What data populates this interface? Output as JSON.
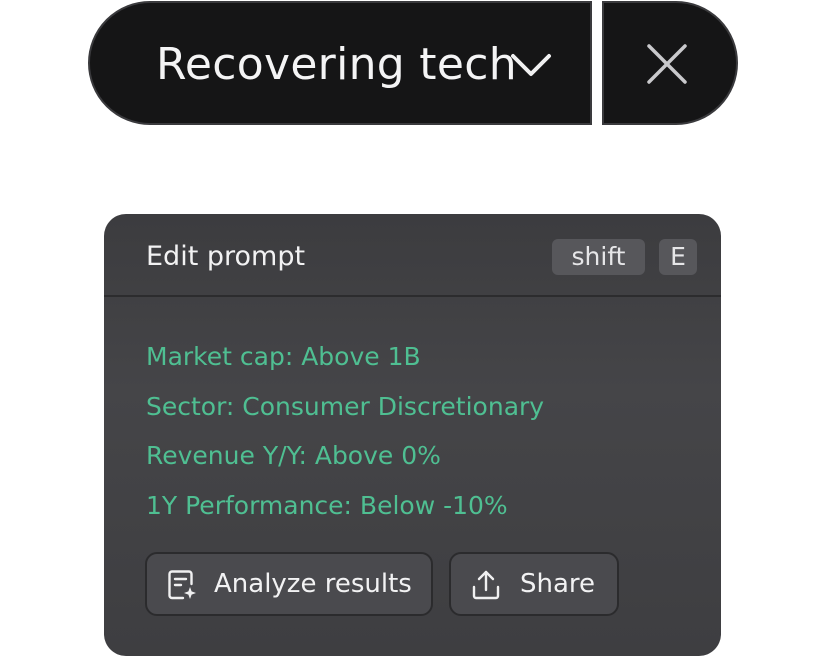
{
  "screen_selector": {
    "title": "Recovering tech",
    "dropdown_icon": "chevron-down-icon",
    "close_icon": "close-icon"
  },
  "prompt_card": {
    "title": "Edit prompt",
    "shortcut_keys": [
      "shift",
      "E"
    ],
    "criteria": [
      "Market cap: Above 1B",
      "Sector: Consumer Discretionary",
      "Revenue Y/Y: Above 0%",
      "1Y Performance: Below -10%"
    ],
    "criteria_color": "#4fbf92",
    "actions": {
      "analyze_label": "Analyze results",
      "analyze_icon": "sparkle-document-icon",
      "share_label": "Share",
      "share_icon": "upload-share-icon"
    }
  }
}
